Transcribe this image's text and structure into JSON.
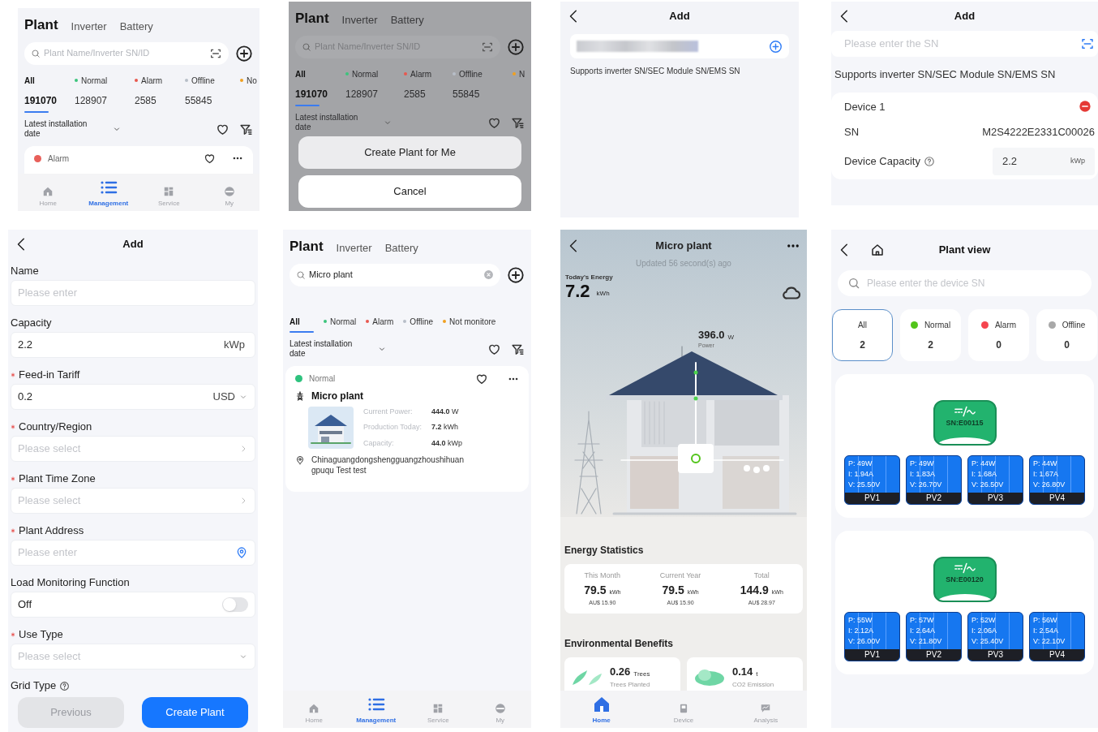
{
  "panels": [
    {
      "kind": "plant_list",
      "tabs": [
        {
          "label": "Plant",
          "selected": true
        },
        {
          "label": "Inverter",
          "selected": false
        },
        {
          "label": "Battery",
          "selected": false
        }
      ],
      "search": {
        "placeholder": "Plant Name/Inverter SN/ID"
      },
      "filters": [
        {
          "label": "All",
          "count": "191070",
          "selected": true
        },
        {
          "label": "Normal",
          "count": "128907",
          "selected": false,
          "color": "#3cc47c"
        },
        {
          "label": "Alarm",
          "count": "2585",
          "selected": false,
          "color": "#e8584f"
        },
        {
          "label": "Offline",
          "count": "55845",
          "selected": false,
          "color": "#b8bec8"
        },
        {
          "label": "No",
          "selected": false,
          "color": "#f0a020"
        }
      ],
      "sort": "Latest installation date",
      "card": {
        "status": "Alarm",
        "color": "#e8605a"
      },
      "nav": [
        {
          "label": "Home",
          "selected": false
        },
        {
          "label": "Management",
          "selected": true
        },
        {
          "label": "Service",
          "selected": false
        },
        {
          "label": "My",
          "selected": false
        }
      ]
    },
    {
      "kind": "action_sheet",
      "tabs": [
        {
          "label": "Plant",
          "selected": true
        },
        {
          "label": "Inverter",
          "selected": false
        },
        {
          "label": "Battery",
          "selected": false
        }
      ],
      "search": {
        "placeholder": "Plant Name/Inverter SN/ID"
      },
      "filters": [
        {
          "label": "All",
          "count": "191070",
          "selected": true
        },
        {
          "label": "Normal",
          "count": "128907",
          "selected": false,
          "color": "#3cc47c"
        },
        {
          "label": "Alarm",
          "count": "2585",
          "selected": false,
          "color": "#e8584f"
        },
        {
          "label": "Offline",
          "count": "55845",
          "selected": false,
          "color": "#b8bec8"
        },
        {
          "label": "N",
          "selected": false,
          "color": "#f0a020"
        }
      ],
      "sort": "Latest installation date",
      "actions": [
        "Create Plant for Me",
        "Cancel"
      ]
    },
    {
      "kind": "add_sn",
      "title": "Add",
      "value_hidden": true,
      "hint": "Supports inverter SN/SEC Module SN/EMS SN"
    },
    {
      "kind": "add_device",
      "title": "Add",
      "placeholder": "Please enter the SN",
      "hint": "Supports inverter SN/SEC Module SN/EMS SN",
      "device": {
        "title": "Device 1",
        "rows": [
          {
            "kind": "text",
            "label": "SN",
            "value": "M2S4222E2331C00026"
          },
          {
            "kind": "input",
            "label": "Device Capacity",
            "help": true,
            "value": "2.2",
            "unit": "kWp"
          }
        ]
      }
    },
    {
      "kind": "add_form",
      "title": "Add",
      "fields": [
        {
          "label": "Name",
          "required": false,
          "kind": "text",
          "placeholder": "Please enter"
        },
        {
          "label": "Capacity",
          "required": false,
          "kind": "text",
          "value": "2.2",
          "unit": "kWp"
        },
        {
          "label": "Feed-in Tariff",
          "required": true,
          "kind": "dropdown",
          "value": "0.2",
          "unit": "USD"
        },
        {
          "label": "Country/Region",
          "required": true,
          "kind": "select",
          "placeholder": "Please select"
        },
        {
          "label": "Plant Time Zone",
          "required": true,
          "kind": "select",
          "placeholder": "Please select"
        },
        {
          "label": "Plant Address",
          "required": true,
          "kind": "location",
          "placeholder": "Please enter"
        },
        {
          "label": "Load Monitoring Function",
          "required": false,
          "kind": "toggle",
          "value": "Off",
          "on": false
        },
        {
          "label": "Use Type",
          "required": true,
          "kind": "dropdown",
          "placeholder": "Please select"
        }
      ],
      "grid_type": {
        "label": "Grid Type",
        "help": true
      },
      "buttons": [
        {
          "label": "Previous",
          "disabled": true
        },
        {
          "label": "Create Plant",
          "disabled": false
        }
      ]
    },
    {
      "kind": "plant_search",
      "tabs": [
        {
          "label": "Plant",
          "selected": true
        },
        {
          "label": "Inverter",
          "selected": false
        },
        {
          "label": "Battery",
          "selected": false
        }
      ],
      "search": {
        "value": "Micro plant"
      },
      "filters": [
        {
          "label": "All",
          "selected": true
        },
        {
          "label": "Normal",
          "selected": false,
          "color": "#3cc47c"
        },
        {
          "label": "Alarm",
          "selected": false,
          "color": "#e8584f"
        },
        {
          "label": "Offline",
          "selected": false,
          "color": "#b8bec8"
        },
        {
          "label": "Not monitore",
          "selected": false,
          "color": "#f0a020"
        }
      ],
      "sort": "Latest installation date",
      "card": {
        "status": "Normal",
        "color": "#2ec27e",
        "name": "Micro plant",
        "metrics": [
          {
            "label": "Current Power:",
            "value": "**444.0** W"
          },
          {
            "label": "Production Today:",
            "value": "**7.2** kWh"
          },
          {
            "label": "Capacity:",
            "value": "**44.0** kWp"
          }
        ],
        "address": "Chinaguangdongshengguangzhoushihuangpuqu Test test"
      },
      "nav": [
        {
          "label": "Home",
          "selected": false
        },
        {
          "label": "Management",
          "selected": true
        },
        {
          "label": "Service",
          "selected": false
        },
        {
          "label": "My",
          "selected": false
        }
      ]
    },
    {
      "kind": "plant_detail",
      "title": "Micro plant",
      "updated": "Updated 56 second(s) ago",
      "energy_label": "Today's Energy",
      "energy_value": "7.2",
      "energy_unit": "kWh",
      "power_value": "396.0",
      "power_unit": "W",
      "power_label": "Power",
      "stats_title": "Energy Statistics",
      "stats": [
        {
          "label": "This Month",
          "value": "79.5",
          "unit": "kWh",
          "money": "AU$ 15.90"
        },
        {
          "label": "Current Year",
          "value": "79.5",
          "unit": "kWh",
          "money": "AU$ 15.90"
        },
        {
          "label": "Total",
          "value": "144.9",
          "unit": "kWh",
          "money": "AU$ 28.97"
        }
      ],
      "benefits_title": "Environmental Benefits",
      "benefits": [
        {
          "value": "0.26",
          "unit": "Trees",
          "label": "Trees Planted"
        },
        {
          "value": "0.14",
          "unit": "t",
          "label": "CO2 Emission"
        }
      ],
      "nav": [
        {
          "label": "Home",
          "selected": true
        },
        {
          "label": "Device",
          "selected": false
        },
        {
          "label": "Analysis",
          "selected": false
        }
      ]
    },
    {
      "kind": "plant_view",
      "title": "Plant view",
      "placeholder": "Please enter the device SN",
      "filters": [
        {
          "label": "All",
          "count": "2",
          "selected": true
        },
        {
          "label": "Normal",
          "count": "2",
          "selected": false,
          "color": "#52c41a"
        },
        {
          "label": "Alarm",
          "count": "0",
          "selected": false,
          "color": "#f5454f"
        },
        {
          "label": "Offline",
          "count": "0",
          "selected": false,
          "color": "#a8a8a8"
        }
      ],
      "inverters": [
        {
          "sn": "SN:E00115",
          "pvs": [
            {
              "p": "P: 49W",
              "i": "I: 1.94A",
              "v": "V: 25.50V",
              "label": "PV1"
            },
            {
              "p": "P: 49W",
              "i": "I: 1.83A",
              "v": "V: 26.70V",
              "label": "PV2"
            },
            {
              "p": "P: 44W",
              "i": "I: 1.68A",
              "v": "V: 26.50V",
              "label": "PV3"
            },
            {
              "p": "P: 44W",
              "i": "I: 1.67A",
              "v": "V: 26.80V",
              "label": "PV4"
            }
          ]
        },
        {
          "sn": "SN:E00120",
          "pvs": [
            {
              "p": "P: 55W",
              "i": "I: 2.12A",
              "v": "V: 26.00V",
              "label": "PV1"
            },
            {
              "p": "P: 57W",
              "i": "I: 2.64A",
              "v": "V: 21.80V",
              "label": "PV2"
            },
            {
              "p": "P: 52W",
              "i": "I: 2.06A",
              "v": "V: 25.40V",
              "label": "PV3"
            },
            {
              "p": "P: 56W",
              "i": "I: 2.54A",
              "v": "V: 22.10V",
              "label": "PV4"
            }
          ]
        }
      ]
    }
  ]
}
